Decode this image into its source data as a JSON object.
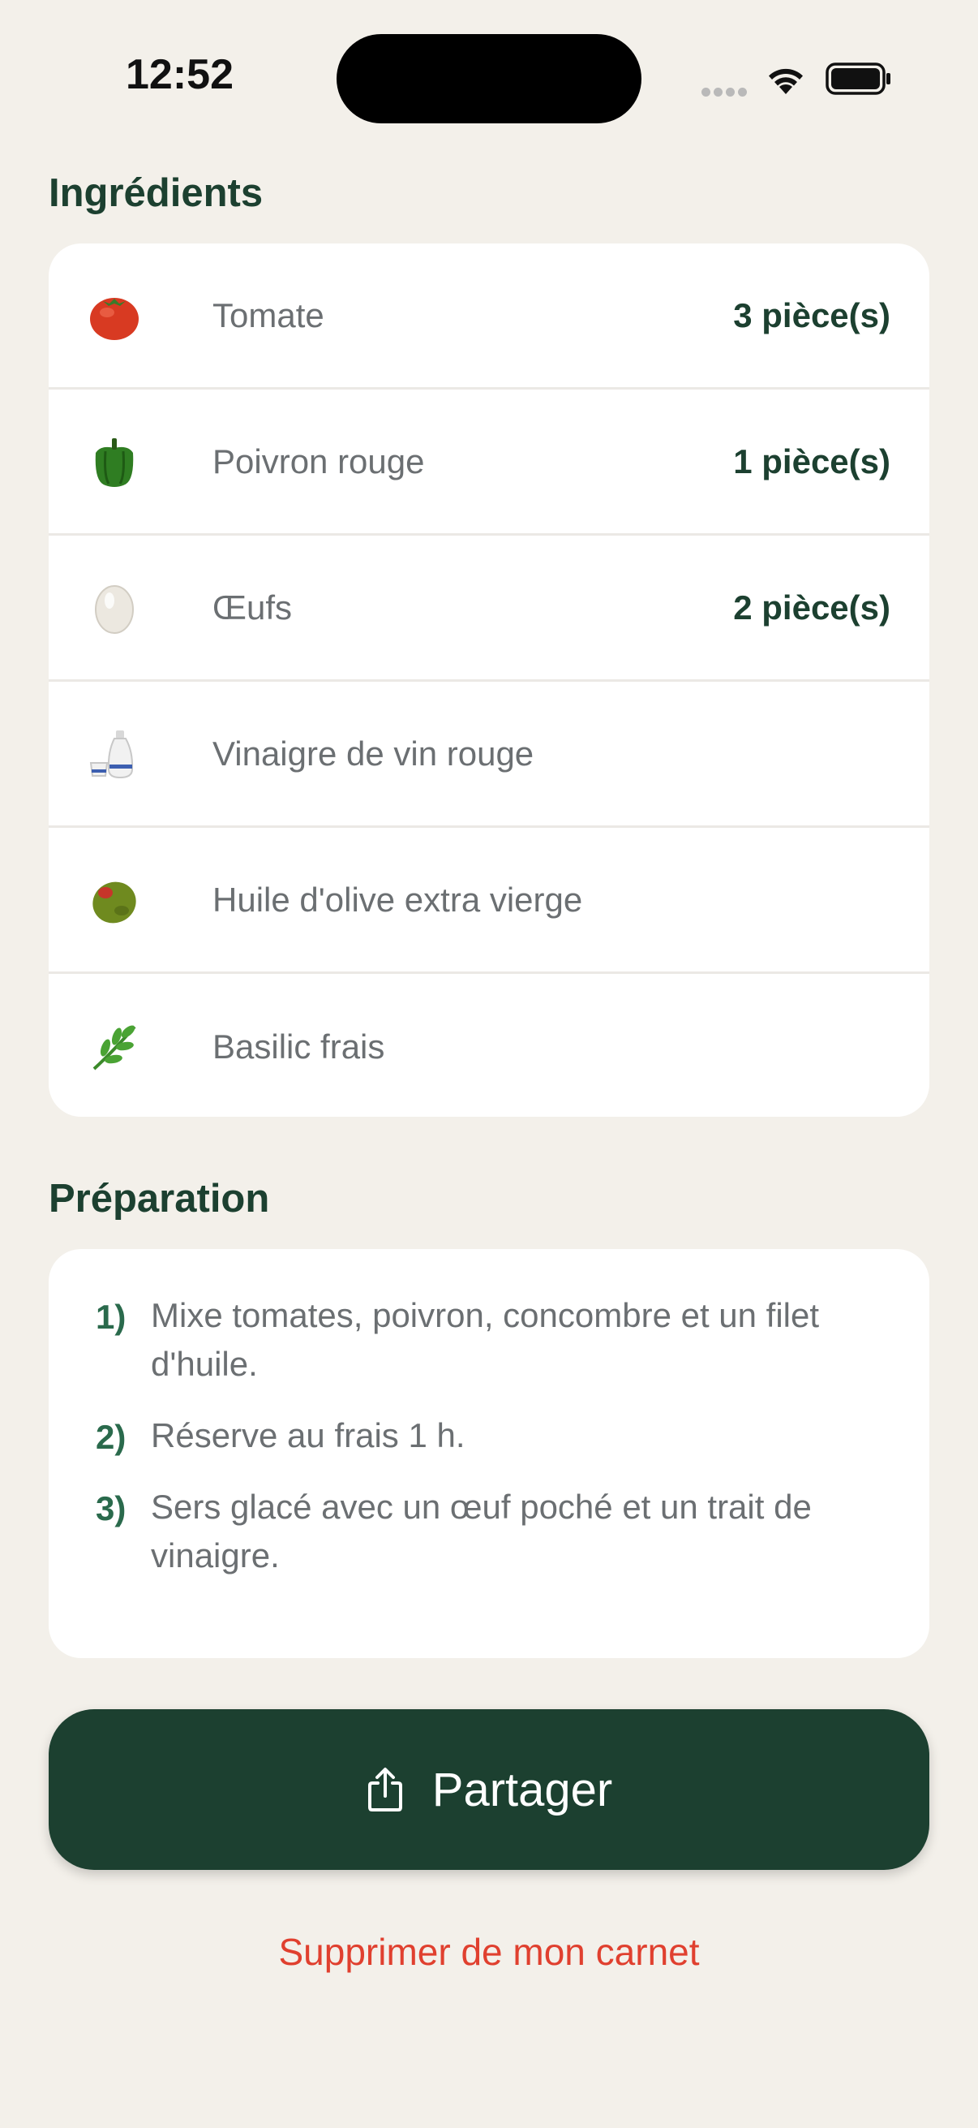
{
  "status_bar": {
    "time": "12:52"
  },
  "ingredients": {
    "title": "Ingrédients",
    "items": [
      {
        "name": "Tomate",
        "qty": "3 pièce(s)",
        "icon": "tomato-icon"
      },
      {
        "name": "Poivron rouge",
        "qty": "1 pièce(s)",
        "icon": "bell-pepper-icon"
      },
      {
        "name": "Œufs",
        "qty": "2 pièce(s)",
        "icon": "egg-icon"
      },
      {
        "name": "Vinaigre de vin rouge",
        "qty": "",
        "icon": "sake-bottle-icon"
      },
      {
        "name": "Huile d'olive extra vierge",
        "qty": "",
        "icon": "olive-icon"
      },
      {
        "name": "Basilic frais",
        "qty": "",
        "icon": "herb-icon"
      }
    ]
  },
  "preparation": {
    "title": "Préparation",
    "steps": [
      {
        "num": "1)",
        "text": "Mixe tomates, poivron, concombre et un filet d'huile."
      },
      {
        "num": "2)",
        "text": "Réserve au frais 1 h."
      },
      {
        "num": "3)",
        "text": "Sers glacé avec un œuf poché et un trait de vinaigre."
      }
    ]
  },
  "actions": {
    "share_label": "Partager",
    "delete_label": "Supprimer de mon carnet"
  },
  "colors": {
    "background": "#f3f0ea",
    "primary": "#1c4030",
    "danger": "#e0402f",
    "muted_text": "#6b6f72"
  }
}
